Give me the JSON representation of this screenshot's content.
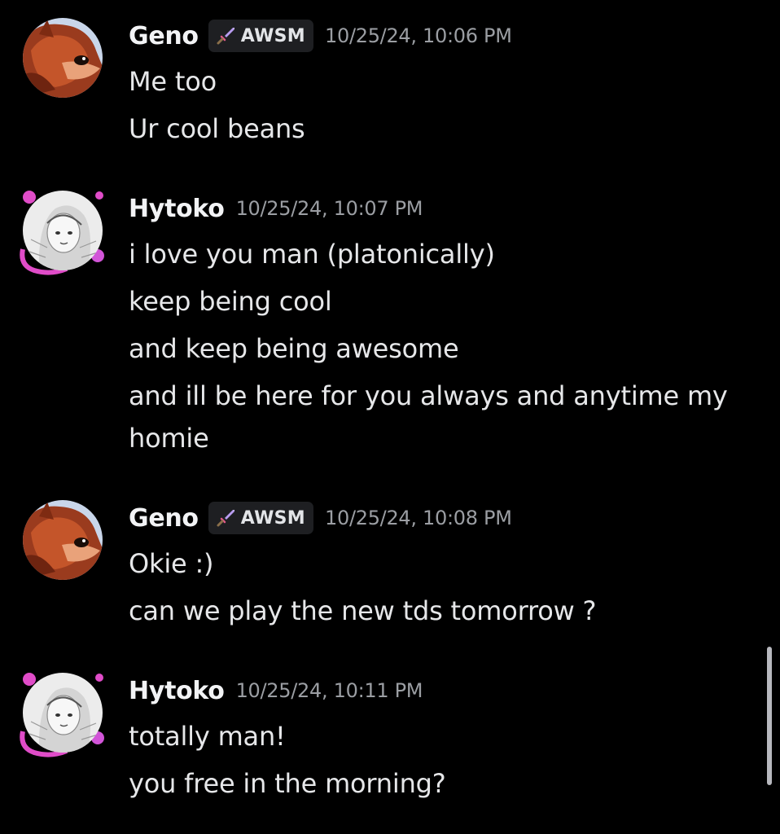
{
  "messages": [
    {
      "author": "Geno",
      "tag": "AWSM",
      "timestamp": "10/25/24, 10:06 PM",
      "avatar_icon": "fox-avatar",
      "lines": [
        "Me too",
        "Ur cool beans"
      ]
    },
    {
      "author": "Hytoko",
      "tag": null,
      "timestamp": "10/25/24, 10:07 PM",
      "avatar_icon": "anime-sketch-avatar",
      "lines": [
        "i love you man (platonically)",
        "keep being cool",
        "and keep being awesome",
        "and ill be here for you always and anytime my homie"
      ]
    },
    {
      "author": "Geno",
      "tag": "AWSM",
      "timestamp": "10/25/24, 10:08 PM",
      "avatar_icon": "fox-avatar",
      "lines": [
        "Okie :)",
        "can we play the new tds tomorrow ?"
      ]
    },
    {
      "author": "Hytoko",
      "tag": null,
      "timestamp": "10/25/24, 10:11 PM",
      "avatar_icon": "anime-sketch-avatar",
      "lines": [
        "totally man!",
        "you free in the morning?"
      ]
    }
  ],
  "colors": {
    "background": "#000000",
    "username": "#f2f3f5",
    "timestamp": "#9b9ea3",
    "message_text": "#e6e7e9",
    "tag_background": "#1e1f22",
    "sword_icon": "#b89cf0",
    "avatar_decoration": "#e04cc8"
  }
}
